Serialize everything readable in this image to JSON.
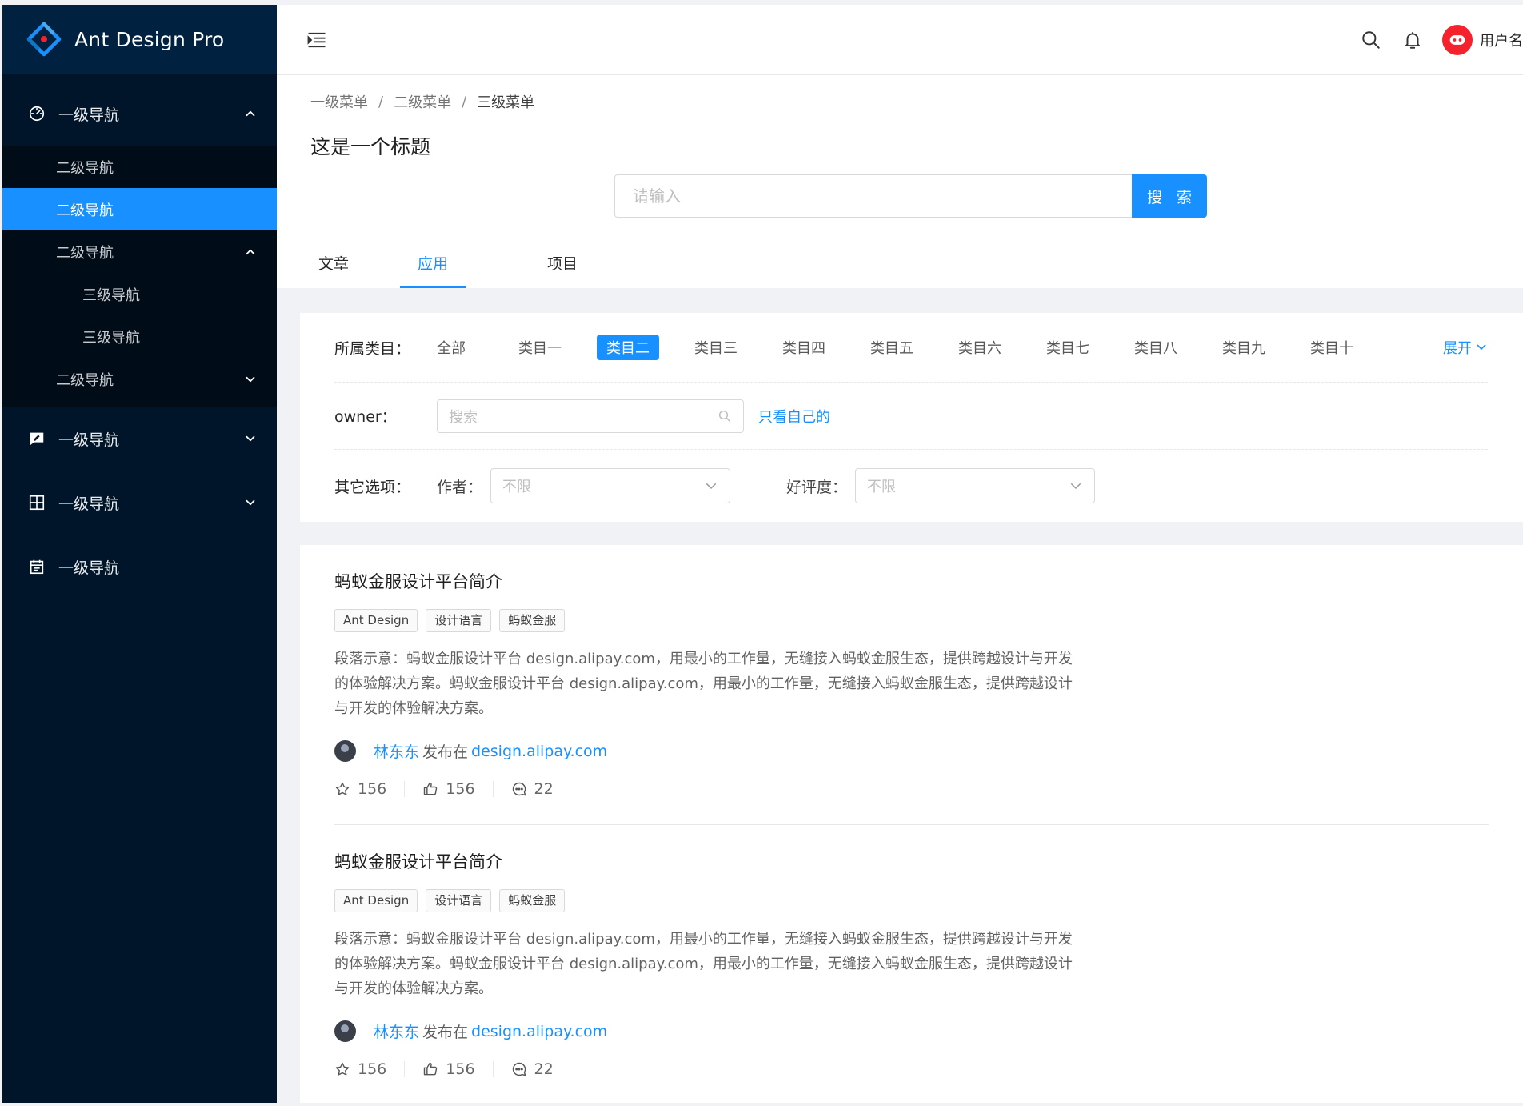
{
  "brand": {
    "name": "Ant Design Pro"
  },
  "sidebar": {
    "items": [
      {
        "label": "一级导航",
        "icon": "dashboard-icon",
        "open": true
      },
      {
        "label": "一级导航",
        "icon": "form-icon"
      },
      {
        "label": "一级导航",
        "icon": "table-icon"
      },
      {
        "label": "一级导航",
        "icon": "profile-icon"
      }
    ],
    "submenu": [
      {
        "label": "二级导航"
      },
      {
        "label": "二级导航",
        "active": true
      },
      {
        "label": "二级导航",
        "open": true
      },
      {
        "label": "三级导航"
      },
      {
        "label": "三级导航"
      },
      {
        "label": "二级导航"
      }
    ]
  },
  "header": {
    "username": "用户名",
    "icons": [
      "menu-fold-icon",
      "search-icon",
      "bell-icon",
      "avatar"
    ]
  },
  "breadcrumb": [
    "一级菜单",
    "二级菜单",
    "三级菜单"
  ],
  "page": {
    "title": "这是一个标题",
    "search_placeholder": "请输入",
    "search_button": "搜 索"
  },
  "tabs": [
    {
      "label": "文章"
    },
    {
      "label": "应用",
      "active": true
    },
    {
      "label": "项目"
    }
  ],
  "filter": {
    "category_label": "所属类目：",
    "categories": [
      "全部",
      "类目一",
      "类目二",
      "类目三",
      "类目四",
      "类目五",
      "类目六",
      "类目七",
      "类目八",
      "类目九",
      "类目十"
    ],
    "selected": "类目二",
    "expand_label": "展开",
    "owner_label": "owner：",
    "owner_placeholder": "搜索",
    "only_mine": "只看自己的",
    "other_label": "其它选项：",
    "author_label": "作者：",
    "author_value": "不限",
    "rating_label": "好评度：",
    "rating_value": "不限"
  },
  "list": [
    {
      "title": "蚂蚁金服设计平台简介",
      "tags": [
        "Ant Design",
        "设计语言",
        "蚂蚁金服"
      ],
      "description": "段落示意：蚂蚁金服设计平台 design.alipay.com，用最小的工作量，无缝接入蚂蚁金服生态，提供跨越设计与开发的体验解决方案。蚂蚁金服设计平台 design.alipay.com，用最小的工作量，无缝接入蚂蚁金服生态，提供跨越设计与开发的体验解决方案。",
      "author": "林东东",
      "published_text": "发布在",
      "link": "design.alipay.com",
      "star": "156",
      "like": "156",
      "message": "22"
    },
    {
      "title": "蚂蚁金服设计平台简介",
      "tags": [
        "Ant Design",
        "设计语言",
        "蚂蚁金服"
      ],
      "description": "段落示意：蚂蚁金服设计平台 design.alipay.com，用最小的工作量，无缝接入蚂蚁金服生态，提供跨越设计与开发的体验解决方案。蚂蚁金服设计平台 design.alipay.com，用最小的工作量，无缝接入蚂蚁金服生态，提供跨越设计与开发的体验解决方案。",
      "author": "林东东",
      "published_text": "发布在",
      "link": "design.alipay.com",
      "star": "156",
      "like": "156",
      "message": "22"
    }
  ],
  "colors": {
    "primary": "#1890ff",
    "sider": "#001529",
    "sider_sub": "#000c17",
    "logo_bg": "#002140"
  }
}
